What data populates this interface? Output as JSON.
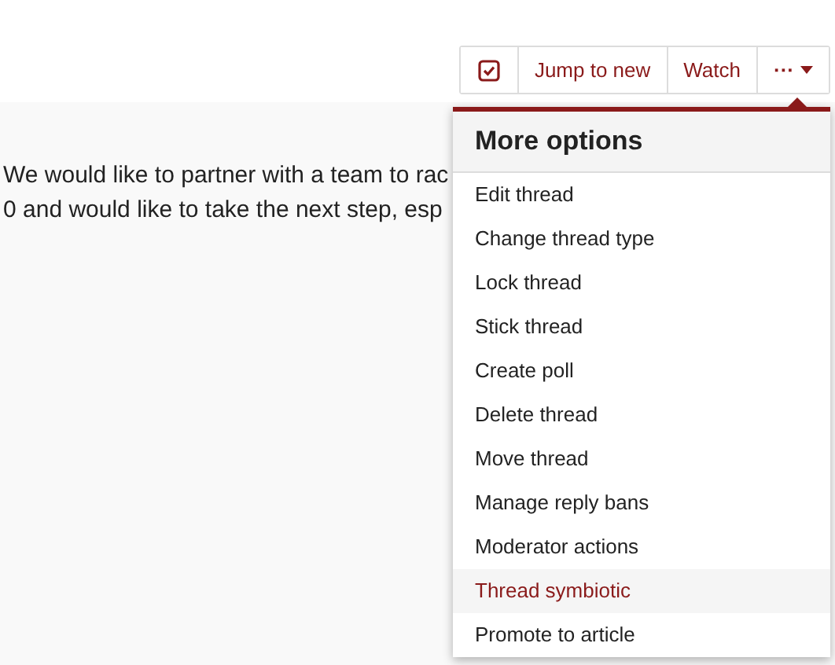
{
  "toolbar": {
    "buttons": [
      {
        "kind": "check",
        "checked": true
      },
      {
        "kind": "text",
        "label": "Jump to new"
      },
      {
        "kind": "text",
        "label": "Watch"
      },
      {
        "kind": "more",
        "label": "···"
      }
    ]
  },
  "post": {
    "lines": [
      "We would like to partner with a team to rac",
      "0 and would like to take the next step, esp"
    ]
  },
  "menu": {
    "title": "More options",
    "items": [
      {
        "label": "Edit thread",
        "highlighted": false
      },
      {
        "label": "Change thread type",
        "highlighted": false
      },
      {
        "label": "Lock thread",
        "highlighted": false
      },
      {
        "label": "Stick thread",
        "highlighted": false
      },
      {
        "label": "Create poll",
        "highlighted": false
      },
      {
        "label": "Delete thread",
        "highlighted": false
      },
      {
        "label": "Move thread",
        "highlighted": false
      },
      {
        "label": "Manage reply bans",
        "highlighted": false
      },
      {
        "label": "Moderator actions",
        "highlighted": false
      },
      {
        "label": "Thread symbiotic",
        "highlighted": true
      },
      {
        "label": "Promote to article",
        "highlighted": false
      }
    ]
  }
}
